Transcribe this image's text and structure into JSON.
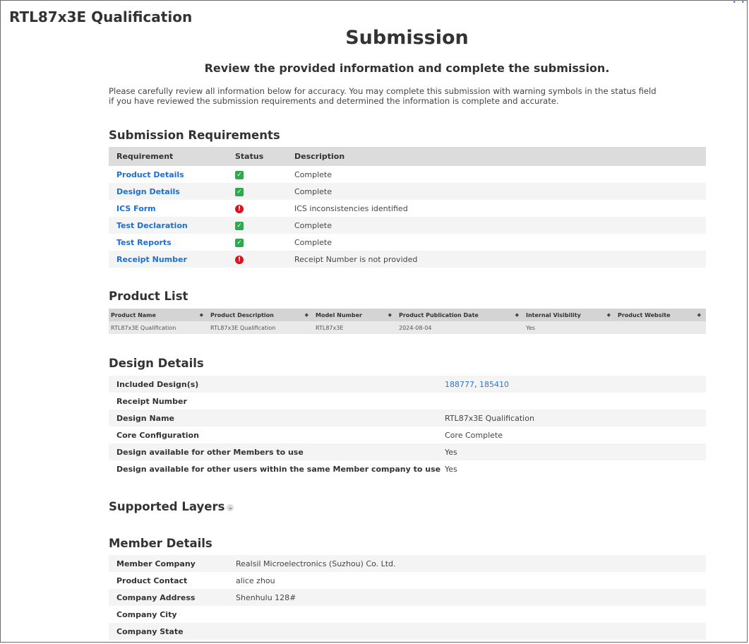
{
  "app_title": "RTL87x3E Qualification",
  "page_title": "Submission",
  "subtitle": "Review the provided information and complete the submission.",
  "intro_line1": "Please carefully review all information below for accuracy. You may complete this submission with warning symbols in the status field",
  "intro_line2": "if you have reviewed the submission requirements and determined the information is complete and accurate.",
  "requirements": {
    "title": "Submission Requirements",
    "headers": [
      "Requirement",
      "Status",
      "Description"
    ],
    "rows": [
      {
        "name": "Product Details",
        "status": "ok",
        "description": "Complete"
      },
      {
        "name": "Design Details",
        "status": "ok",
        "description": "Complete"
      },
      {
        "name": "ICS Form",
        "status": "warning",
        "description": "ICS inconsistencies identified"
      },
      {
        "name": "Test Declaration",
        "status": "ok",
        "description": "Complete"
      },
      {
        "name": "Test Reports",
        "status": "ok",
        "description": "Complete"
      },
      {
        "name": "Receipt Number",
        "status": "warning",
        "description": "Receipt Number is not provided"
      }
    ]
  },
  "product_list": {
    "title": "Product List",
    "headers": [
      "Product Name",
      "Product Description",
      "Model Number",
      "Product Publication Date",
      "Internal Visibility",
      "Product Website"
    ],
    "rows": [
      [
        "RTL87x3E Qualification",
        "RTL87x3E Qualification",
        "RTL87x3E",
        "2024-08-04",
        "Yes",
        ""
      ]
    ]
  },
  "design_details": {
    "title": "Design Details",
    "included_label": "Included Design(s)",
    "included_1": "188777",
    "included_sep": ",",
    "included_2": "185410",
    "rows": [
      {
        "label": "Receipt Number",
        "value": ""
      },
      {
        "label": "Design Name",
        "value": "RTL87x3E Qualification"
      },
      {
        "label": "Core Configuration",
        "value": "Core Complete"
      },
      {
        "label": "Design available for other Members to use",
        "value": "Yes"
      },
      {
        "label": "Design available for other users within the same Member company to use",
        "value": "Yes"
      }
    ]
  },
  "supported_layers": {
    "title": "Supported Layers"
  },
  "member_details": {
    "title": "Member Details",
    "rows": [
      {
        "label": "Member Company",
        "value": "Realsil Microelectronics (Suzhou) Co. Ltd."
      },
      {
        "label": "Product Contact",
        "value": "alice zhou"
      },
      {
        "label": "Company Address",
        "value": "Shenhulu 128#"
      },
      {
        "label": "Company City",
        "value": ""
      },
      {
        "label": "Company State",
        "value": ""
      }
    ]
  },
  "icons": {
    "ok": "check-square-icon",
    "warning": "exclamation-circle-icon",
    "sort": "sort-arrows-icon",
    "expand": "chevron-down-icon"
  },
  "colors": {
    "ok": "#2fa84f",
    "warning": "#d9141e",
    "link": "#1a6fd6"
  }
}
